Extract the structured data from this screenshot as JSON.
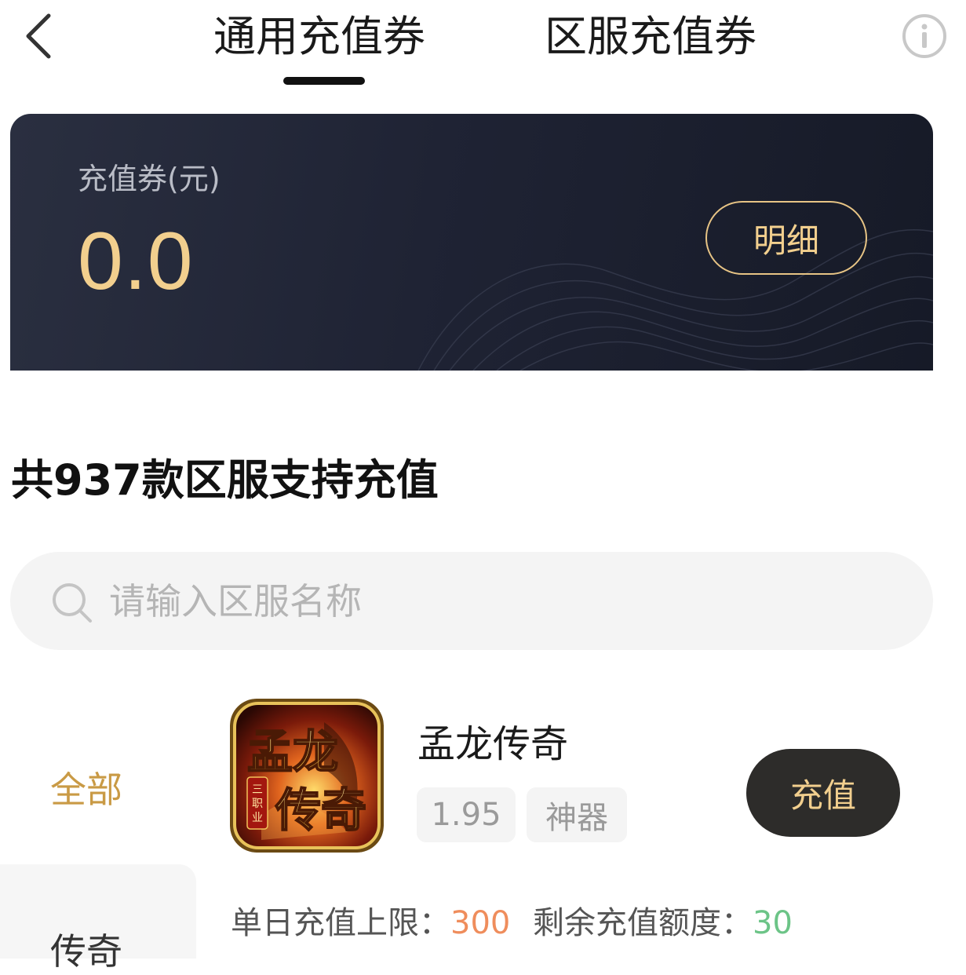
{
  "header": {
    "tabs": [
      {
        "label": "通用充值券",
        "active": true
      },
      {
        "label": "区服充值券",
        "active": false
      }
    ],
    "back_icon": "chevron-left-icon",
    "info_icon": "info-circle-icon"
  },
  "balance_card": {
    "label": "充值券(元)",
    "amount": "0.0",
    "detail_button": "明细"
  },
  "section": {
    "title": "共937款区服支持充值"
  },
  "search": {
    "placeholder": "请输入区服名称",
    "value": "",
    "icon": "search-icon"
  },
  "categories": [
    {
      "label": "全部",
      "active": true
    },
    {
      "label": "传奇",
      "active": false
    }
  ],
  "games": [
    {
      "name": "孟龙传奇",
      "icon_text_main": "孟龙传奇",
      "icon_text_badge": "三职业",
      "tags": [
        "1.95",
        "神器"
      ],
      "action_label": "充值",
      "daily_limit_label": "单日充值上限：",
      "daily_limit_value": "300",
      "remaining_label": "剩余充值额度：",
      "remaining_value": "30"
    }
  ],
  "colors": {
    "accent_gold": "#f2cf8e",
    "category_active": "#c99a45",
    "limit_value": "#ef8d5c",
    "remaining_value": "#6cc487",
    "card_bg": "#1f2334"
  }
}
